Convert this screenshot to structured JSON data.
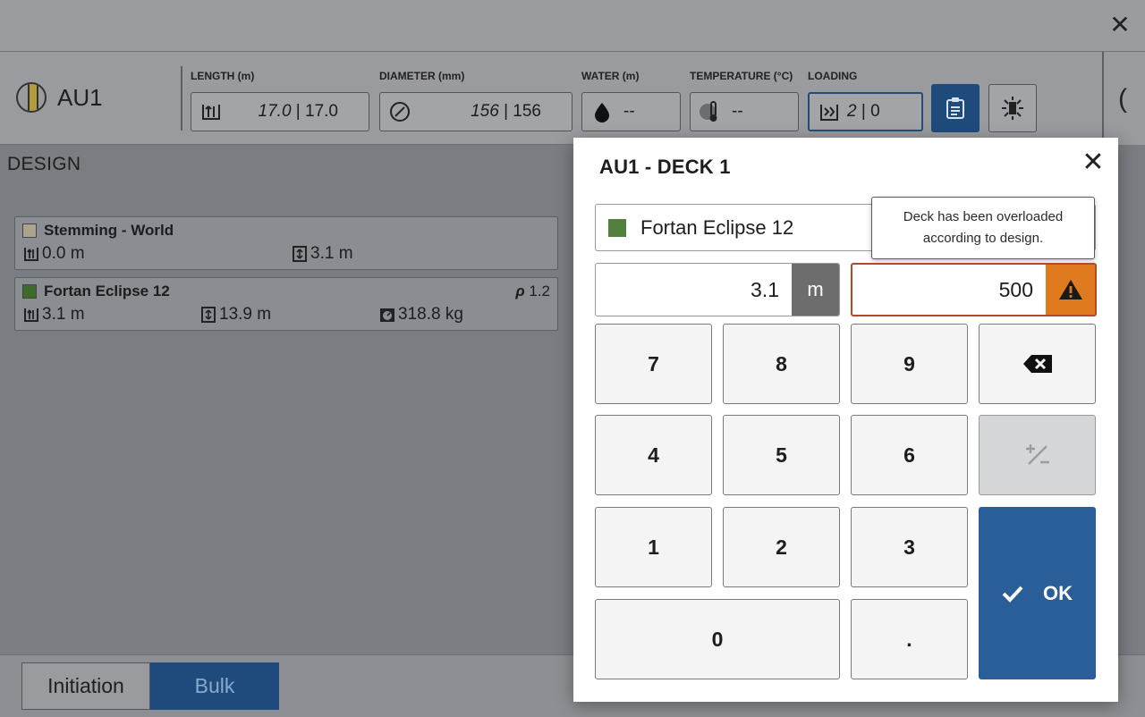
{
  "hole": {
    "name": "AU1"
  },
  "metrics": {
    "length": {
      "label": "LENGTH (m)",
      "design": "17.0",
      "actual": " | 17.0"
    },
    "diameter": {
      "label": "DIAMETER (mm)",
      "design": "156",
      "actual": " | 156"
    },
    "water": {
      "label": "WATER (m)",
      "value": "--"
    },
    "temperature": {
      "label": "TEMPERATURE (°C)",
      "value": "--"
    },
    "loading": {
      "label": "LOADING",
      "design": "2",
      "actual": " | 0"
    }
  },
  "design": {
    "title": "DESIGN",
    "decks": [
      {
        "name": "Stemming - World",
        "color": "#a9a48b",
        "top": "0.0 m",
        "length": "3.1 m"
      },
      {
        "name": "Fortan Eclipse 12",
        "color": "#3d6a2d",
        "rho_symbol": "ρ",
        "rho": " 1.2",
        "top": "3.1 m",
        "length": "13.9 m",
        "weight": "318.8 kg"
      }
    ]
  },
  "bottom": {
    "tabs": [
      "Initiation",
      "Bulk"
    ],
    "active_tab": "Bulk"
  },
  "modal": {
    "title": "AU1 - DECK 1",
    "product": {
      "name": "Fortan Eclipse 12",
      "color": "#52803f"
    },
    "tooltip": "Deck has been overloaded according to design.",
    "length_value": "3.1",
    "length_unit": "m",
    "amount_value": "500",
    "keys": {
      "k7": "7",
      "k8": "8",
      "k9": "9",
      "k4": "4",
      "k5": "5",
      "k6": "6",
      "k1": "1",
      "k2": "2",
      "k3": "3",
      "k0": "0",
      "kdot": "."
    },
    "ok_label": "OK"
  },
  "icons": {
    "close": "close-icon",
    "length": "length-icon",
    "diameter": "diameter-icon",
    "water": "water-drop-icon",
    "temperature": "thermometer-icon",
    "loading": "loading-icon",
    "clipboard": "clipboard-icon",
    "explosion": "explosion-icon",
    "warning": "warning-icon",
    "backspace": "backspace-icon",
    "plus-minus": "plus-minus-icon",
    "check": "check-icon"
  },
  "colors": {
    "primary": "#1f4b7c",
    "ok": "#2a5e99",
    "warning": "#e07a1f",
    "warning_border": "#b5482a"
  }
}
